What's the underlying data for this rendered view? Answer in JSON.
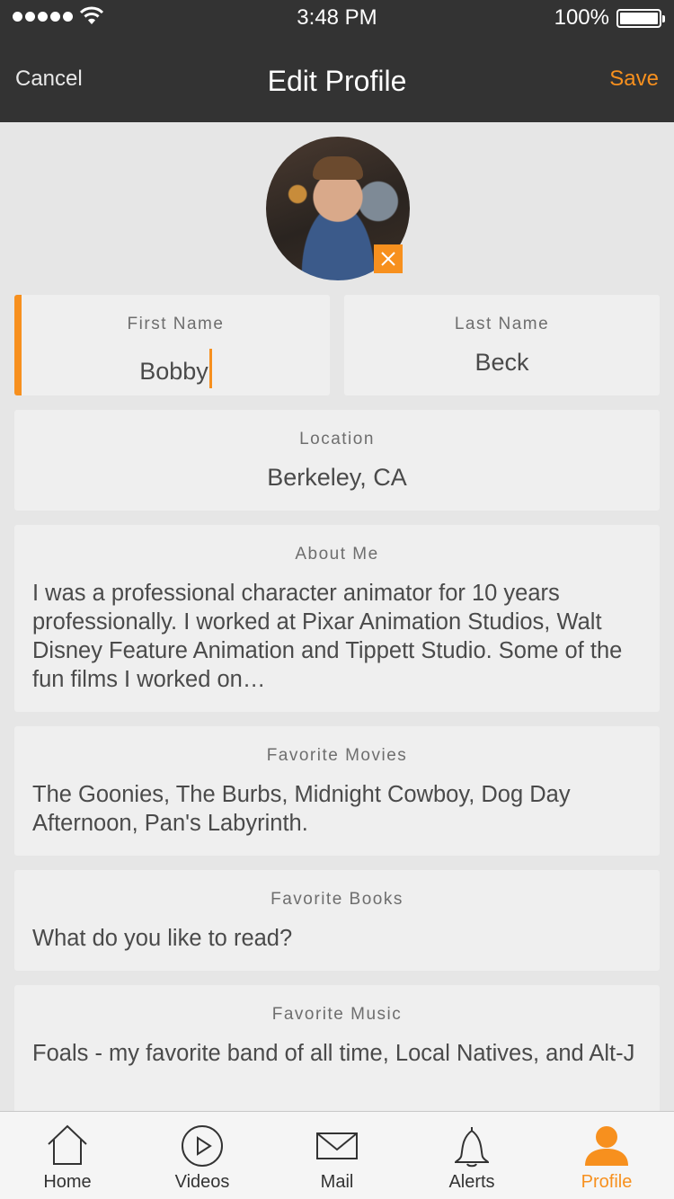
{
  "status_bar": {
    "time": "3:48 PM",
    "battery": "100%",
    "signal_icon": "signal-dots-icon",
    "wifi_icon": "wifi-icon",
    "battery_icon": "battery-icon"
  },
  "nav": {
    "cancel_label": "Cancel",
    "title": "Edit Profile",
    "save_label": "Save"
  },
  "avatar": {
    "badge_icon": "close-icon"
  },
  "fields": {
    "first_name": {
      "label": "First Name",
      "value": "Bobby"
    },
    "last_name": {
      "label": "Last Name",
      "value": "Beck"
    },
    "location": {
      "label": "Location",
      "value": "Berkeley, CA"
    },
    "about_me": {
      "label": "About Me",
      "value": "I was a professional character animator for 10 years professionally. I worked at Pixar Animation Studios, Walt Disney Feature Animation and Tippett Studio. Some of the fun films I worked on…"
    },
    "favorite_movies": {
      "label": "Favorite Movies",
      "value": "The Goonies, The Burbs, Midnight Cowboy, Dog Day Afternoon, Pan's Labyrinth."
    },
    "favorite_books": {
      "label": "Favorite Books",
      "placeholder": "What do you like to read?"
    },
    "favorite_music": {
      "label": "Favorite Music",
      "value": "Foals - my favorite band of all time, Local Natives, and Alt-J"
    }
  },
  "tabs": [
    {
      "label": "Home",
      "icon": "home-icon"
    },
    {
      "label": "Videos",
      "icon": "play-icon"
    },
    {
      "label": "Mail",
      "icon": "mail-icon"
    },
    {
      "label": "Alerts",
      "icon": "bell-icon"
    },
    {
      "label": "Profile",
      "icon": "person-icon",
      "active": true
    }
  ],
  "colors": {
    "accent": "#f7901e",
    "header_bg": "#333333",
    "page_bg": "#e6e6e6",
    "card_bg": "#efefef"
  }
}
